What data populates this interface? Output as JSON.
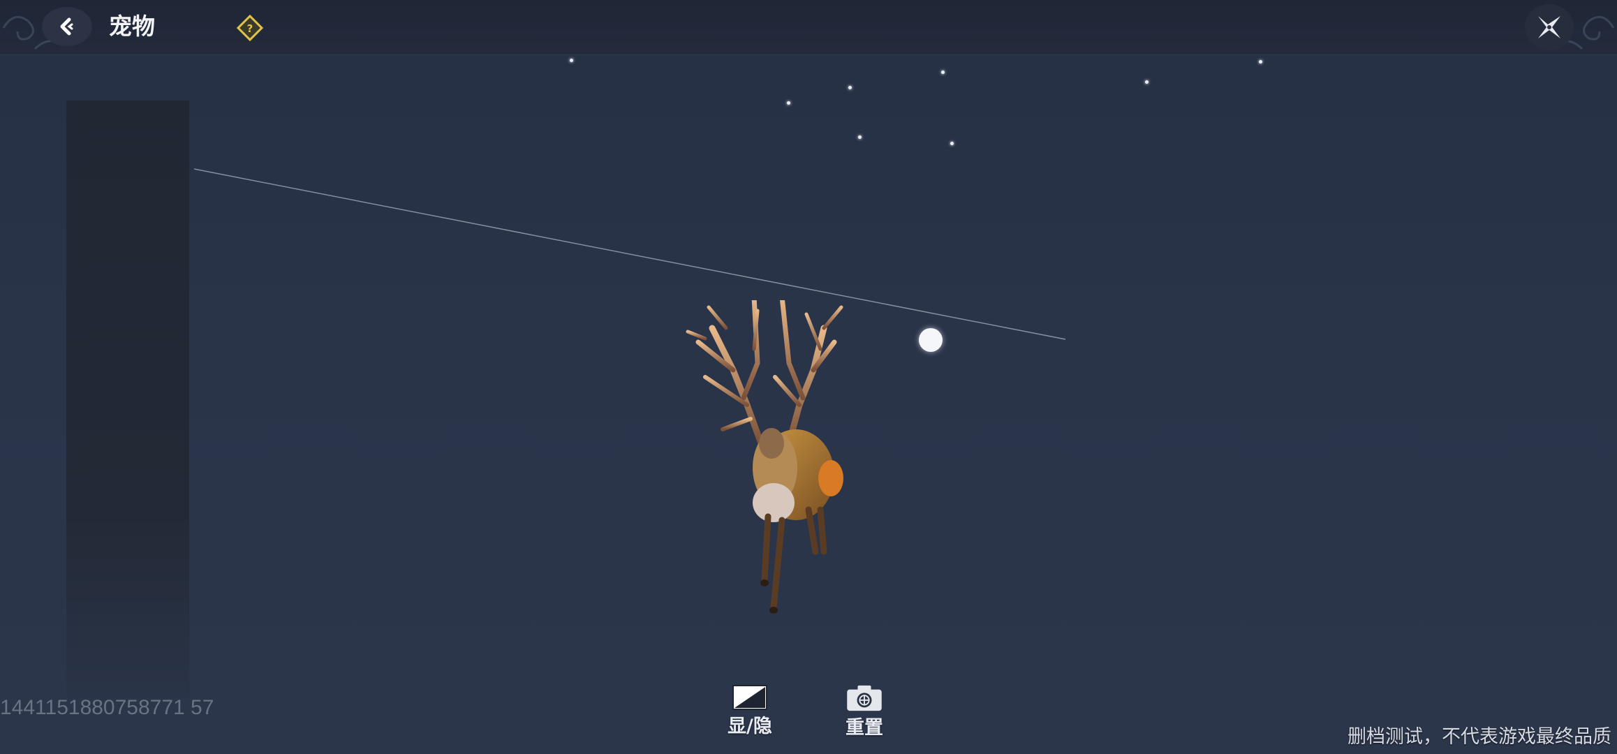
{
  "header": {
    "title": "宠物",
    "back_icon": "chevron-left-icon",
    "help_icon": "question-diamond-icon",
    "close_icon": "close-shuriken-icon"
  },
  "toolbar": {
    "toggle_label": "显/隐",
    "toggle_icon": "half-square-icon",
    "reset_label": "重置",
    "reset_icon": "camera-reset-icon"
  },
  "player_id": "1441151880758771 57",
  "disclaimer": "删档测试，不代表游戏最终品质",
  "colors": {
    "background": "#2a3447",
    "top_bar": "#1f2636",
    "help_accent": "#e3c24a",
    "text": "#f3f4f6"
  }
}
